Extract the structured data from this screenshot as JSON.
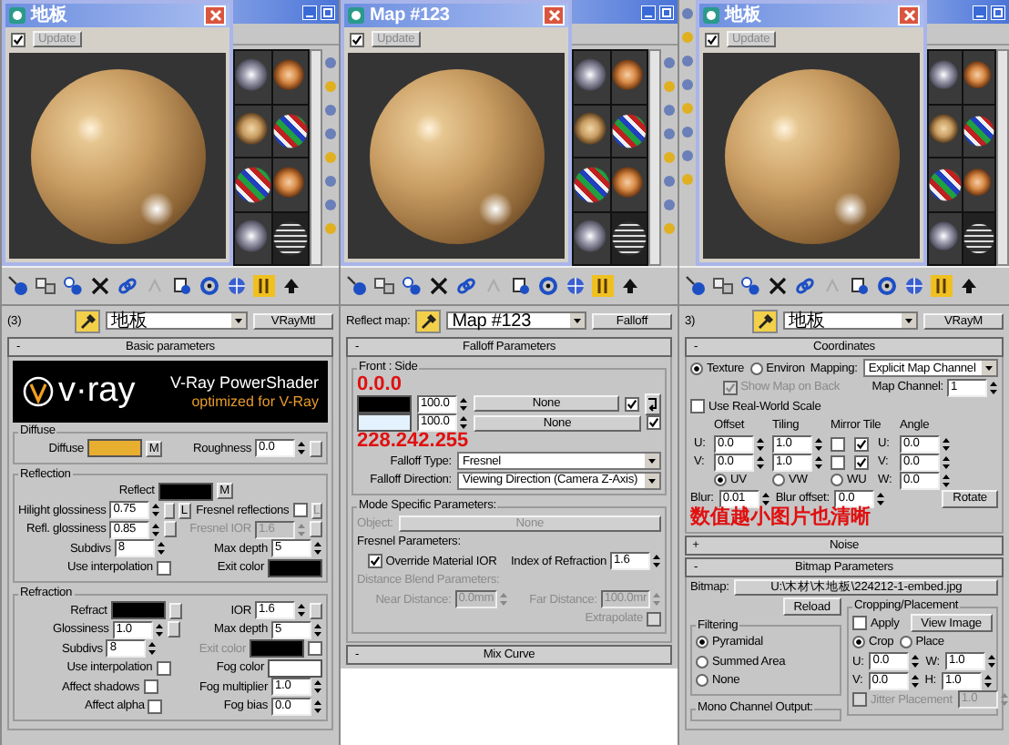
{
  "panels": [
    {
      "kind": "material",
      "preview": {
        "title": "地板",
        "auto": true,
        "update": {
          "text": "Update",
          "disabled": true
        }
      },
      "name_row": {
        "label": "(3)",
        "name": "地板",
        "type": "VRayMtl"
      },
      "rollouts": [
        {
          "sign": "-",
          "title": "Basic parameters",
          "blocks": [
            {
              "kind": "banner",
              "logo": "v·ray",
              "title": "V-Ray PowerShader",
              "subtitle": "optimized for V-Ray"
            },
            {
              "kind": "group",
              "title": "Diffuse",
              "rows": [
                {
                  "left": [
                    {
                      "kind": "label",
                      "text": "Diffuse"
                    },
                    {
                      "kind": "swatch",
                      "color": "#e8ae30"
                    },
                    {
                      "kind": "button",
                      "text": "M"
                    }
                  ],
                  "right": [
                    {
                      "kind": "label",
                      "text": "Roughness"
                    },
                    {
                      "kind": "spinner",
                      "value": "0.0"
                    },
                    {
                      "kind": "mapslot"
                    }
                  ]
                }
              ]
            },
            {
              "kind": "group",
              "title": "Reflection",
              "rows": [
                {
                  "left": [
                    {
                      "kind": "label",
                      "text": "Reflect"
                    },
                    {
                      "kind": "swatch",
                      "color": "#000000"
                    },
                    {
                      "kind": "button",
                      "text": "M"
                    }
                  ],
                  "right": []
                },
                {
                  "left": [
                    {
                      "kind": "label",
                      "text": "Hilight glossiness"
                    },
                    {
                      "kind": "spinner",
                      "value": "0.75"
                    },
                    {
                      "kind": "mapslot"
                    },
                    {
                      "kind": "button",
                      "text": "L"
                    }
                  ],
                  "right": [
                    {
                      "kind": "label",
                      "text": "Fresnel reflections"
                    },
                    {
                      "kind": "checkbox",
                      "checked": false
                    },
                    {
                      "kind": "dimbutton",
                      "text": "L"
                    }
                  ]
                },
                {
                  "left": [
                    {
                      "kind": "label",
                      "text": "Refl. glossiness"
                    },
                    {
                      "kind": "spinner",
                      "value": "0.85"
                    },
                    {
                      "kind": "mapslot"
                    }
                  ],
                  "right": [
                    {
                      "kind": "dimlabel",
                      "text": "Fresnel IOR"
                    },
                    {
                      "kind": "dimspinner",
                      "value": "1.6"
                    },
                    {
                      "kind": "mapslot"
                    }
                  ]
                },
                {
                  "left": [
                    {
                      "kind": "label",
                      "text": "Subdivs"
                    },
                    {
                      "kind": "spinner",
                      "value": "8"
                    }
                  ],
                  "right": [
                    {
                      "kind": "label",
                      "text": "Max depth"
                    },
                    {
                      "kind": "spinner",
                      "value": "5"
                    }
                  ]
                },
                {
                  "left": [
                    {
                      "kind": "label",
                      "text": "Use interpolation"
                    },
                    {
                      "kind": "checkbox",
                      "checked": false
                    }
                  ],
                  "right": [
                    {
                      "kind": "label",
                      "text": "Exit color"
                    },
                    {
                      "kind": "swatch",
                      "color": "#000000"
                    }
                  ]
                }
              ]
            },
            {
              "kind": "group",
              "title": "Refraction",
              "rows": [
                {
                  "left": [
                    {
                      "kind": "label",
                      "text": "Refract"
                    },
                    {
                      "kind": "swatch",
                      "color": "#000000"
                    },
                    {
                      "kind": "mapslot"
                    }
                  ],
                  "right": [
                    {
                      "kind": "label",
                      "text": "IOR"
                    },
                    {
                      "kind": "spinner",
                      "value": "1.6"
                    },
                    {
                      "kind": "mapslot"
                    }
                  ]
                },
                {
                  "left": [
                    {
                      "kind": "label",
                      "text": "Glossiness"
                    },
                    {
                      "kind": "spinner",
                      "value": "1.0"
                    },
                    {
                      "kind": "mapslot"
                    }
                  ],
                  "right": [
                    {
                      "kind": "label",
                      "text": "Max depth"
                    },
                    {
                      "kind": "spinner",
                      "value": "5"
                    }
                  ]
                },
                {
                  "left": [
                    {
                      "kind": "label",
                      "text": "Subdivs"
                    },
                    {
                      "kind": "spinner",
                      "value": "8"
                    }
                  ],
                  "right": [
                    {
                      "kind": "dimlabel",
                      "text": "Exit color"
                    },
                    {
                      "kind": "swatch",
                      "color": "#000000"
                    },
                    {
                      "kind": "checkbox",
                      "checked": false
                    }
                  ]
                },
                {
                  "left": [
                    {
                      "kind": "label",
                      "text": "Use interpolation"
                    },
                    {
                      "kind": "checkbox",
                      "checked": false
                    }
                  ],
                  "right": [
                    {
                      "kind": "label",
                      "text": "Fog color"
                    },
                    {
                      "kind": "swatch",
                      "color": "#ffffff"
                    }
                  ]
                },
                {
                  "left": [
                    {
                      "kind": "label",
                      "text": "Affect shadows"
                    },
                    {
                      "kind": "checkbox",
                      "checked": false
                    }
                  ],
                  "right": [
                    {
                      "kind": "label",
                      "text": "Fog multiplier"
                    },
                    {
                      "kind": "spinner",
                      "value": "1.0"
                    }
                  ]
                },
                {
                  "left": [
                    {
                      "kind": "label",
                      "text": "Affect alpha"
                    },
                    {
                      "kind": "checkbox",
                      "checked": false
                    }
                  ],
                  "right": [
                    {
                      "kind": "label",
                      "text": "Fog bias"
                    },
                    {
                      "kind": "spinner",
                      "value": "0.0"
                    }
                  ]
                }
              ]
            }
          ]
        }
      ]
    },
    {
      "kind": "map",
      "preview": {
        "title": "Map #123",
        "auto": true,
        "update": {
          "text": "Update",
          "disabled": true
        }
      },
      "name_row": {
        "label": "Reflect map:",
        "name": "Map #123",
        "type": "Falloff"
      },
      "rollouts": [
        {
          "sign": "-",
          "title": "Falloff Parameters",
          "blocks": [
            {
              "kind": "group",
              "title": "Front : Side",
              "rows": [
                {
                  "items": [
                    {
                      "kind": "note",
                      "text": "0.0.0"
                    }
                  ]
                },
                {
                  "items": [
                    {
                      "kind": "swatch",
                      "color": "#000000"
                    },
                    {
                      "kind": "spinner",
                      "value": "100.0"
                    },
                    {
                      "kind": "widebutton",
                      "text": "None"
                    },
                    {
                      "kind": "checkbox",
                      "checked": true
                    },
                    {
                      "kind": "swapbutton"
                    }
                  ]
                },
                {
                  "items": [
                    {
                      "kind": "swatch",
                      "color": "#e4f2ff"
                    },
                    {
                      "kind": "spinner",
                      "value": "100.0"
                    },
                    {
                      "kind": "widebutton",
                      "text": "None"
                    },
                    {
                      "kind": "checkbox",
                      "checked": true
                    }
                  ]
                },
                {
                  "items": [
                    {
                      "kind": "note",
                      "text": "228.242.255"
                    }
                  ]
                },
                {
                  "items": [
                    {
                      "kind": "formlabel",
                      "text": "Falloff Type:"
                    },
                    {
                      "kind": "dropdown",
                      "value": "Fresnel"
                    }
                  ]
                },
                {
                  "items": [
                    {
                      "kind": "formlabel",
                      "text": "Falloff Direction:"
                    },
                    {
                      "kind": "dropdown",
                      "value": "Viewing Direction (Camera Z-Axis)"
                    }
                  ]
                }
              ]
            },
            {
              "kind": "group",
              "title": "Mode Specific Parameters:",
              "rows": [
                {
                  "items": [
                    {
                      "kind": "dimlabel",
                      "text": "Object:"
                    },
                    {
                      "kind": "dimwidebutton",
                      "text": "None"
                    }
                  ]
                },
                {
                  "items": [
                    {
                      "kind": "label",
                      "text": "Fresnel Parameters:"
                    }
                  ]
                },
                {
                  "left": [
                    {
                      "kind": "checkbox",
                      "checked": true,
                      "text": "Override Material IOR"
                    }
                  ],
                  "right": [
                    {
                      "kind": "label",
                      "text": "Index of Refraction"
                    },
                    {
                      "kind": "spinner",
                      "value": "1.6"
                    }
                  ]
                },
                {
                  "items": [
                    {
                      "kind": "dimlabel",
                      "text": "Distance Blend Parameters:"
                    }
                  ]
                },
                {
                  "left": [
                    {
                      "kind": "dimlabel",
                      "text": "Near Distance:"
                    },
                    {
                      "kind": "dimspinner",
                      "value": "0.0mm"
                    }
                  ],
                  "right": [
                    {
                      "kind": "dimlabel",
                      "text": "Far Distance:"
                    },
                    {
                      "kind": "dimspinner",
                      "value": "100.0mr"
                    }
                  ]
                },
                {
                  "right": [
                    {
                      "kind": "dimlabel",
                      "text": "Extrapolate"
                    },
                    {
                      "kind": "dimcheckbox",
                      "checked": false
                    }
                  ]
                }
              ]
            }
          ]
        },
        {
          "sign": "-",
          "title": "Mix Curve"
        }
      ]
    },
    {
      "kind": "material",
      "preview": {
        "title": "地板",
        "auto": true,
        "update": {
          "text": "Update",
          "disabled": true
        }
      },
      "name_row": {
        "label": "3)",
        "name": "地板",
        "type": "VRayM"
      },
      "rollouts": [
        {
          "sign": "-",
          "title": "Coordinates",
          "blocks": [
            {
              "kind": "rows",
              "rows": [
                {
                  "items": [
                    {
                      "kind": "radio",
                      "text": "Texture",
                      "selected": true
                    },
                    {
                      "kind": "radio",
                      "text": "Environ",
                      "selected": false
                    },
                    {
                      "kind": "label",
                      "text": "Mapping:"
                    },
                    {
                      "kind": "dropdown",
                      "value": "Explicit Map Channel"
                    }
                  ]
                },
                {
                  "left": [
                    {
                      "kind": "dimcheckbox",
                      "checked": true,
                      "text": "Show Map on Back"
                    }
                  ],
                  "right": [
                    {
                      "kind": "label",
                      "text": "Map Channel:"
                    },
                    {
                      "kind": "spinner",
                      "value": "1"
                    }
                  ]
                },
                {
                  "items": [
                    {
                      "kind": "checkbox",
                      "checked": false,
                      "text": "Use Real-World Scale"
                    }
                  ]
                }
              ]
            },
            {
              "kind": "table",
              "rows": [
                [
                  null,
                  {
                    "kind": "label",
                    "text": "Offset"
                  },
                  {
                    "kind": "label",
                    "text": "Tiling"
                  },
                  {
                    "kind": "label",
                    "text": "Mirror Tile"
                  },
                  null,
                  null,
                  {
                    "kind": "label",
                    "text": "Angle"
                  }
                ],
                [
                  {
                    "kind": "label",
                    "text": "U:"
                  },
                  {
                    "kind": "spinner",
                    "value": "0.0"
                  },
                  {
                    "kind": "spinner",
                    "value": "1.0"
                  },
                  {
                    "kind": "checkbox",
                    "checked": false
                  },
                  {
                    "kind": "checkbox",
                    "checked": true
                  },
                  {
                    "kind": "label",
                    "text": "U:"
                  },
                  {
                    "kind": "spinner",
                    "value": "0.0"
                  }
                ],
                [
                  {
                    "kind": "label",
                    "text": "V:"
                  },
                  {
                    "kind": "spinner",
                    "value": "0.0"
                  },
                  {
                    "kind": "spinner",
                    "value": "1.0"
                  },
                  {
                    "kind": "checkbox",
                    "checked": false
                  },
                  {
                    "kind": "checkbox",
                    "checked": true
                  },
                  {
                    "kind": "label",
                    "text": "V:"
                  },
                  {
                    "kind": "spinner",
                    "value": "0.0"
                  }
                ],
                [
                  null,
                  {
                    "kind": "radio",
                    "text": "UV",
                    "selected": true
                  },
                  {
                    "kind": "radio",
                    "text": "VW",
                    "selected": false
                  },
                  {
                    "kind": "radio",
                    "text": "WU",
                    "selected": false
                  },
                  null,
                  {
                    "kind": "label",
                    "text": "W:"
                  },
                  {
                    "kind": "spinner",
                    "value": "0.0"
                  }
                ]
              ]
            },
            {
              "kind": "rows",
              "rows": [
                {
                  "items": [
                    {
                      "kind": "label",
                      "text": "Blur:"
                    },
                    {
                      "kind": "spinner",
                      "value": "0.01"
                    },
                    {
                      "kind": "label",
                      "text": "Blur offset:"
                    },
                    {
                      "kind": "spinner",
                      "value": "0.0"
                    },
                    {
                      "kind": "pushbutton",
                      "text": "Rotate"
                    }
                  ]
                },
                {
                  "items": [
                    {
                      "kind": "note",
                      "text": "数值越小图片也清晰"
                    }
                  ]
                }
              ]
            }
          ]
        },
        {
          "sign": "+",
          "title": "Noise"
        },
        {
          "sign": "-",
          "title": "Bitmap Parameters",
          "blocks": [
            {
              "kind": "rows",
              "rows": [
                {
                  "items": [
                    {
                      "kind": "label",
                      "text": "Bitmap:"
                    },
                    {
                      "kind": "pathbutton",
                      "text": "U:\\木材\\木地板\\224212-1-embed.jpg"
                    }
                  ]
                }
              ]
            },
            {
              "kind": "columns",
              "columns": [
                [
                  {
                    "kind": "rows",
                    "rows": [
                      {
                        "items": [
                          {
                            "kind": "pushbutton",
                            "text": "Reload"
                          }
                        ]
                      }
                    ]
                  },
                  {
                    "kind": "group",
                    "title": "Filtering",
                    "rows": [
                      {
                        "items": [
                          {
                            "kind": "radio",
                            "text": "Pyramidal",
                            "selected": true
                          }
                        ]
                      },
                      {
                        "items": [
                          {
                            "kind": "radio",
                            "text": "Summed Area",
                            "selected": false
                          }
                        ]
                      },
                      {
                        "items": [
                          {
                            "kind": "radio",
                            "text": "None",
                            "selected": false
                          }
                        ]
                      }
                    ]
                  },
                  {
                    "kind": "group",
                    "title": "Mono Channel Output:"
                  }
                ],
                [
                  {
                    "kind": "group",
                    "title": "Cropping/Placement",
                    "rows": [
                      {
                        "items": [
                          {
                            "kind": "checkbox",
                            "checked": false,
                            "text": "Apply"
                          },
                          {
                            "kind": "pushbutton",
                            "text": "View Image"
                          }
                        ]
                      },
                      {
                        "items": [
                          {
                            "kind": "radio",
                            "text": "Crop",
                            "selected": true
                          },
                          {
                            "kind": "radio",
                            "text": "Place",
                            "selected": false
                          }
                        ]
                      },
                      {
                        "items": [
                          {
                            "kind": "label",
                            "text": "U:"
                          },
                          {
                            "kind": "spinner",
                            "value": "0.0"
                          },
                          {
                            "kind": "label",
                            "text": "W:"
                          },
                          {
                            "kind": "spinner",
                            "value": "1.0"
                          }
                        ]
                      },
                      {
                        "items": [
                          {
                            "kind": "label",
                            "text": "V:"
                          },
                          {
                            "kind": "spinner",
                            "value": "0.0"
                          },
                          {
                            "kind": "label",
                            "text": "H:"
                          },
                          {
                            "kind": "spinner",
                            "value": "1.0"
                          }
                        ]
                      },
                      {
                        "items": [
                          {
                            "kind": "dimcheckbox",
                            "checked": false,
                            "text": "Jitter Placement"
                          },
                          {
                            "kind": "dimspinner",
                            "value": "1.0"
                          }
                        ]
                      }
                    ]
                  }
                ]
              ]
            }
          ]
        }
      ]
    }
  ]
}
